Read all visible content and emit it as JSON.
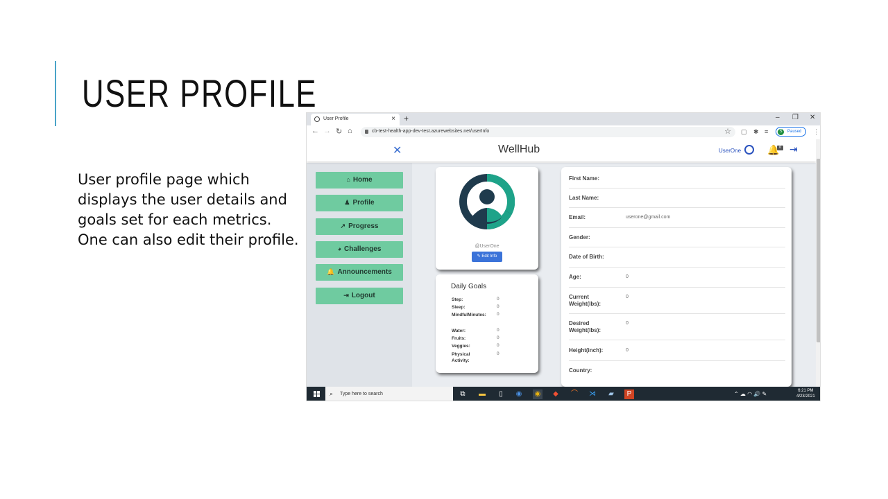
{
  "slide": {
    "title": "USER PROFILE",
    "body": "User profile page which displays the user details and goals set for each metrics. One can also edit their profile."
  },
  "browser": {
    "tab_title": "User Profile",
    "url": "cb-test-health-app-dev-test.azurewebsites.net/userInfo",
    "profile_initial": "S",
    "profile_status": "Paused"
  },
  "app": {
    "brand": "WellHub",
    "username": "UserOne",
    "notification_count": "0",
    "accent": "#6fcba0",
    "nav": [
      {
        "label": "Home",
        "icon": "home-icon",
        "glyph": "⌂"
      },
      {
        "label": "Profile",
        "icon": "user-icon",
        "glyph": "♟"
      },
      {
        "label": "Progress",
        "icon": "chart-line-icon",
        "glyph": "↗"
      },
      {
        "label": "Challenges",
        "icon": "pie-chart-icon",
        "glyph": "◕"
      },
      {
        "label": "Announcements",
        "icon": "bell-icon",
        "glyph": "🔔"
      },
      {
        "label": "Logout",
        "icon": "logout-icon",
        "glyph": "⇥"
      }
    ],
    "profile": {
      "handle": "@UserOne",
      "edit_label": "Edit Info"
    },
    "goals": {
      "title": "Daily Goals",
      "items": [
        {
          "label": "Step:",
          "value": "0"
        },
        {
          "label": "Sleep:",
          "value": "0"
        },
        {
          "label": "MindfulMinutes:",
          "value": "0"
        },
        {
          "label": "Water:",
          "value": "0"
        },
        {
          "label": "Fruits:",
          "value": "0"
        },
        {
          "label": "Veggies:",
          "value": "0"
        },
        {
          "label": "Physical Activity:",
          "value": "0"
        }
      ]
    },
    "details": [
      {
        "label": "First Name:",
        "value": ""
      },
      {
        "label": "Last Name:",
        "value": ""
      },
      {
        "label": "Email:",
        "value": "userone@gmail.com"
      },
      {
        "label": "Gender:",
        "value": ""
      },
      {
        "label": "Date of Birth:",
        "value": ""
      },
      {
        "label": "Age:",
        "value": "0"
      },
      {
        "label": "Current Weight(lbs):",
        "value": "0"
      },
      {
        "label": "Desired Weight(lbs):",
        "value": "0"
      },
      {
        "label": "Height(inch):",
        "value": "0"
      },
      {
        "label": "Country:",
        "value": ""
      }
    ]
  },
  "taskbar": {
    "search_placeholder": "Type here to search",
    "time": "6:21 PM",
    "date": "4/23/2021"
  }
}
